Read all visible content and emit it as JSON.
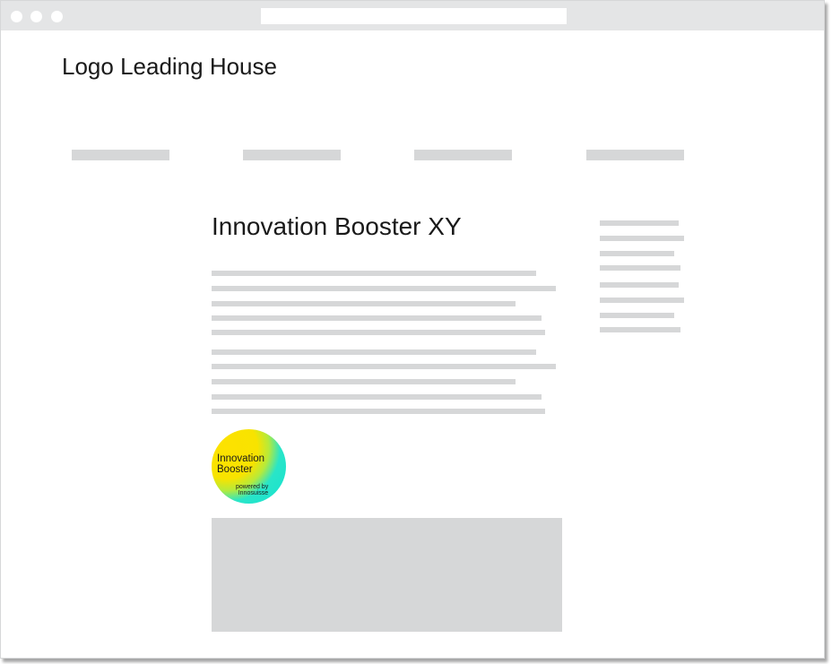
{
  "site": {
    "logo_text": "Logo Leading House",
    "page_title": "Innovation Booster XY"
  },
  "navigation": {
    "items": [
      {
        "label": ""
      },
      {
        "label": ""
      },
      {
        "label": ""
      },
      {
        "label": ""
      }
    ]
  },
  "badge": {
    "title_line1": "Innovation",
    "title_line2": "Booster",
    "subtitle_line1": "powered by",
    "subtitle_line2": "Innosuisse",
    "colors": {
      "yellow": "#FDE200",
      "cyan": "#13E3D2"
    }
  },
  "theme": {
    "placeholder_gray": "#D6D7D8",
    "chrome_gray": "#E4E5E6",
    "text": "#1A1A1A"
  }
}
